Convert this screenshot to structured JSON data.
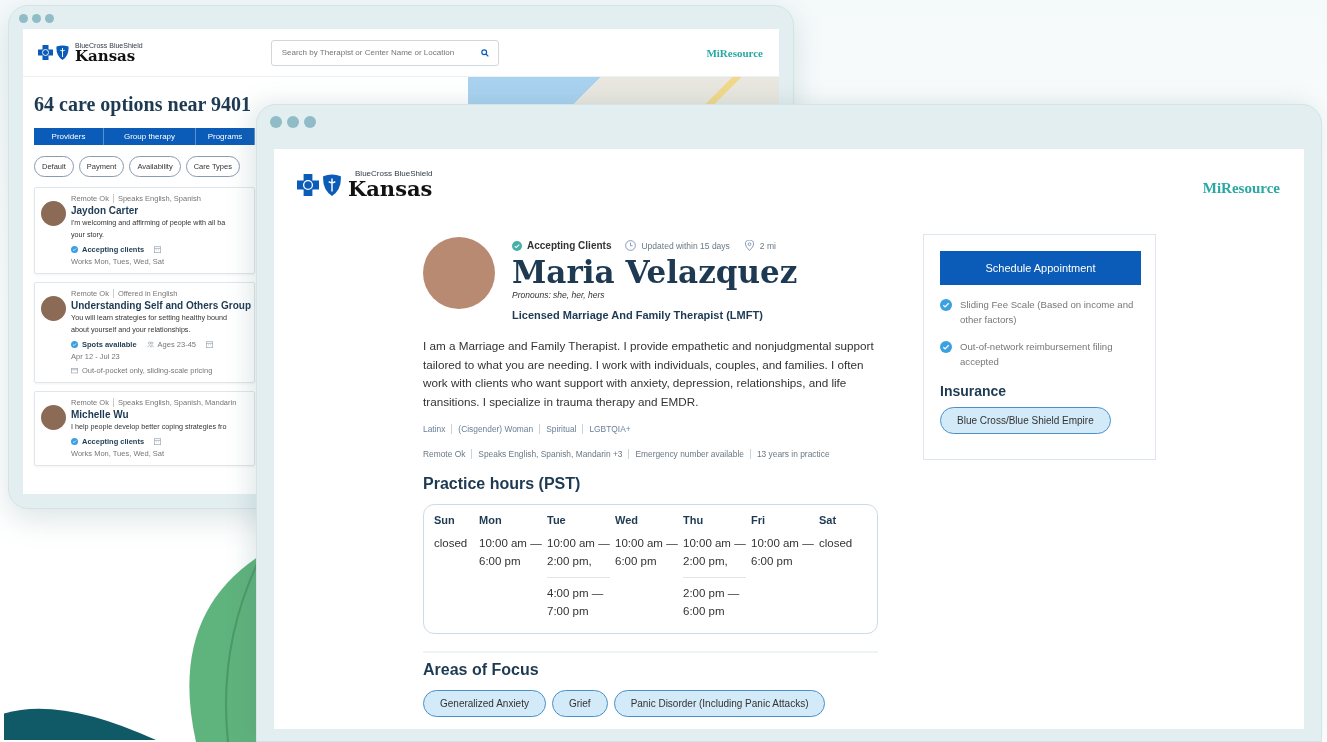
{
  "back_window": {
    "header": {
      "logo_small": "BlueCross BlueShield",
      "logo_large": "Kansas",
      "search": {
        "placeholder": "Search by Therapist or Center Name or Location"
      },
      "brand": "MiResource"
    },
    "heading": "64 care options near 9401",
    "tabs": [
      "Providers",
      "Group therapy",
      "Programs"
    ],
    "filters": [
      "Default",
      "Payment",
      "Availability",
      "Care Types"
    ],
    "results": [
      {
        "meta": [
          "Remote Ok",
          "Speaks English, Spanish"
        ],
        "name": "Jaydon Carter",
        "description": [
          "I'm welcoming and affirming of people with all ba",
          "your story."
        ],
        "status": "Accepting clients",
        "details": [
          {
            "kind": "schedule",
            "text": "Works Mon, Tues, Wed, Sat"
          }
        ]
      },
      {
        "meta": [
          "Remote Ok",
          "Offered in English"
        ],
        "name": "Understanding Self and Others Group",
        "description": [
          "You will learn strategies for setting healthy bound",
          "about yourself and your relationships."
        ],
        "status": "Spots available",
        "details": [
          {
            "kind": "ages",
            "text": "Ages 23-45"
          },
          {
            "kind": "dates",
            "text": "Apr 12 - Jul 23"
          }
        ],
        "note": "Out-of-pocket only, sliding-scale pricing"
      },
      {
        "meta": [
          "Remote Ok",
          "Speaks English, Spanish, Mandarin"
        ],
        "name": "Michelle Wu",
        "description": [
          "I help people develop better coping strategies fro"
        ],
        "status": "Accepting clients",
        "details": [
          {
            "kind": "schedule",
            "text": "Works Mon, Tues, Wed, Sat"
          }
        ]
      }
    ]
  },
  "front_window": {
    "header": {
      "logo_small": "BlueCross BlueShield",
      "logo_large": "Kansas",
      "brand": "MiResource"
    },
    "profile": {
      "status": "Accepting Clients",
      "updated": "Updated within 15 days",
      "distance": "2 mi",
      "name": "Maria Velazquez",
      "pronouns": "Pronouns: she, her, hers",
      "license": "Licensed Marriage And Family Therapist (LMFT)",
      "bio": "I am a Marriage and Family Therapist. I provide empathetic and nonjudgmental support tailored to what you are needing. I work with individuals, couples, and families. I often work with clients who want support with anxiety, depression, relationships, and life transitions. I specialize in trauma therapy and EMDR.",
      "identities": [
        "Latinx",
        "(Cisgender) Woman",
        "Spiritual",
        "LGBTQIA+"
      ],
      "facts": [
        "Remote Ok",
        "Speaks English, Spanish, Mandarin +3",
        "Emergency number available",
        "13 years in practice"
      ]
    },
    "hours": {
      "title": "Practice hours (PST)",
      "days": [
        {
          "day": "Sun",
          "slots": [
            "closed"
          ]
        },
        {
          "day": "Mon",
          "slots": [
            "10:00 am — 6:00 pm"
          ]
        },
        {
          "day": "Tue",
          "slots": [
            "10:00 am — 2:00 pm,",
            "4:00 pm — 7:00 pm"
          ]
        },
        {
          "day": "Wed",
          "slots": [
            "10:00 am — 6:00 pm"
          ]
        },
        {
          "day": "Thu",
          "slots": [
            "10:00 am — 2:00 pm,",
            "2:00 pm — 6:00 pm"
          ]
        },
        {
          "day": "Fri",
          "slots": [
            "10:00 am — 6:00 pm"
          ]
        },
        {
          "day": "Sat",
          "slots": [
            "closed"
          ]
        }
      ]
    },
    "focus": {
      "title": "Areas of Focus",
      "areas": [
        "Generalized Anxiety",
        "Grief",
        "Panic Disorder (Including Panic Attacks)"
      ]
    },
    "sidebar": {
      "button": "Schedule Appointment",
      "features": [
        "Sliding Fee Scale (Based on income and other factors)",
        "Out-of-network reimbursement filing accepted"
      ],
      "insurance_title": "Insurance",
      "insurance": [
        "Blue Cross/Blue Shield Empire"
      ]
    }
  }
}
